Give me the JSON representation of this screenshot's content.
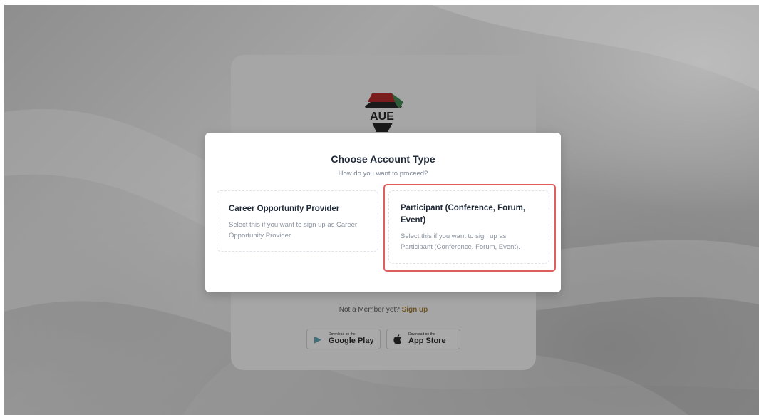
{
  "background_card": {
    "logo_text": "AUE",
    "member_prompt": "Not a Member yet?",
    "signup_link": "Sign up",
    "stores": [
      {
        "small": "Download on the",
        "big": "Google Play",
        "icon": "google-play-icon"
      },
      {
        "small": "Download on the",
        "big": "App Store",
        "icon": "apple-icon"
      }
    ]
  },
  "modal": {
    "title": "Choose Account Type",
    "subtitle": "How do you want to proceed?",
    "options": [
      {
        "title": "Career Opportunity Provider",
        "description": "Select this if you want to sign up as Career Opportunity Provider."
      },
      {
        "title": "Participant (Conference, Forum, Event)",
        "description": "Select this if you want to sign up as Participant (Conference, Forum, Event)."
      }
    ]
  },
  "colors": {
    "highlight": "#e05d5d",
    "title_text": "#1f2937",
    "muted_text": "#8a919d",
    "signup_link": "#c9973a"
  }
}
